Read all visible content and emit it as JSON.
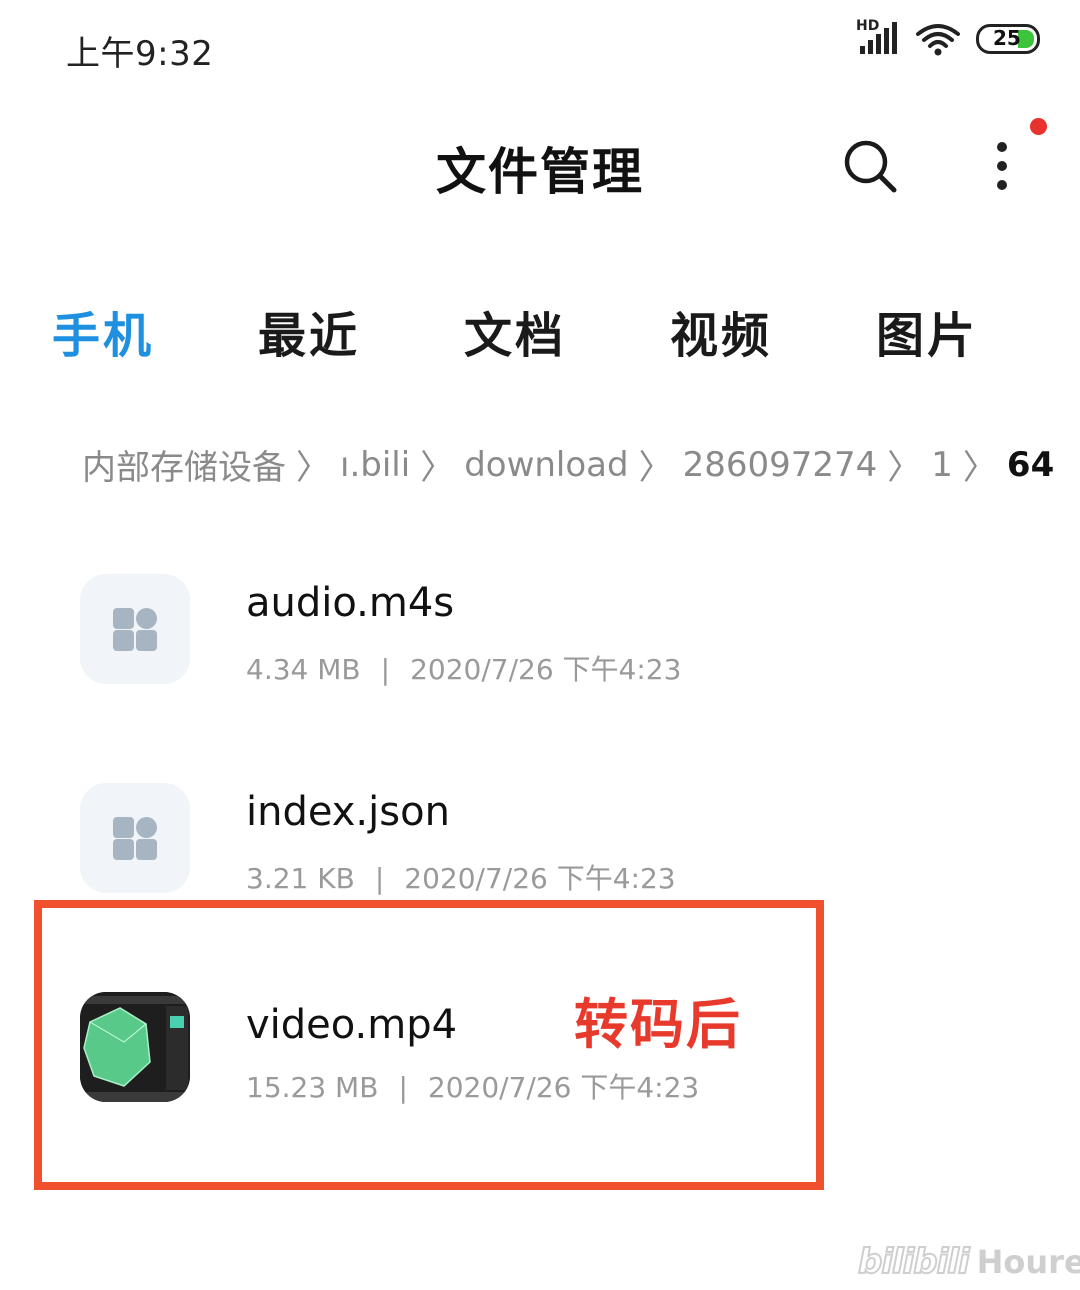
{
  "status_bar": {
    "time": "上午9:32",
    "signal_label": "HD",
    "battery_level": "25",
    "battery_color": "#3cc43c"
  },
  "header": {
    "title": "文件管理",
    "search_icon": "search-icon",
    "more_icon": "more-vertical-icon",
    "notification_dot_color": "#e8322e"
  },
  "tabs": [
    {
      "label": "手机",
      "active": true
    },
    {
      "label": "最近",
      "active": false
    },
    {
      "label": "文档",
      "active": false
    },
    {
      "label": "视频",
      "active": false
    },
    {
      "label": "图片",
      "active": false
    }
  ],
  "accent_color": "#1f8fe0",
  "breadcrumb": {
    "items": [
      "内部存储设备",
      "ı.bili",
      "download",
      "286097274",
      "1"
    ],
    "current": "64",
    "separator": "〉"
  },
  "files": [
    {
      "name": "audio.m4s",
      "size": "4.34 MB",
      "date": "2020/7/26 下午4:23",
      "icon": "app-grid-icon"
    },
    {
      "name": "index.json",
      "size": "3.21 KB",
      "date": "2020/7/26 下午4:23",
      "icon": "app-grid-icon"
    },
    {
      "name": "video.mp4",
      "size": "15.23 MB",
      "date": "2020/7/26 下午4:23",
      "icon": "video-thumbnail"
    }
  ],
  "meta_divider": "|",
  "annotation": {
    "text": "转码后",
    "color": "#e83a2c",
    "box_color": "#f0502e"
  },
  "watermark": {
    "logo": "bilibili",
    "text": "Hourea"
  }
}
